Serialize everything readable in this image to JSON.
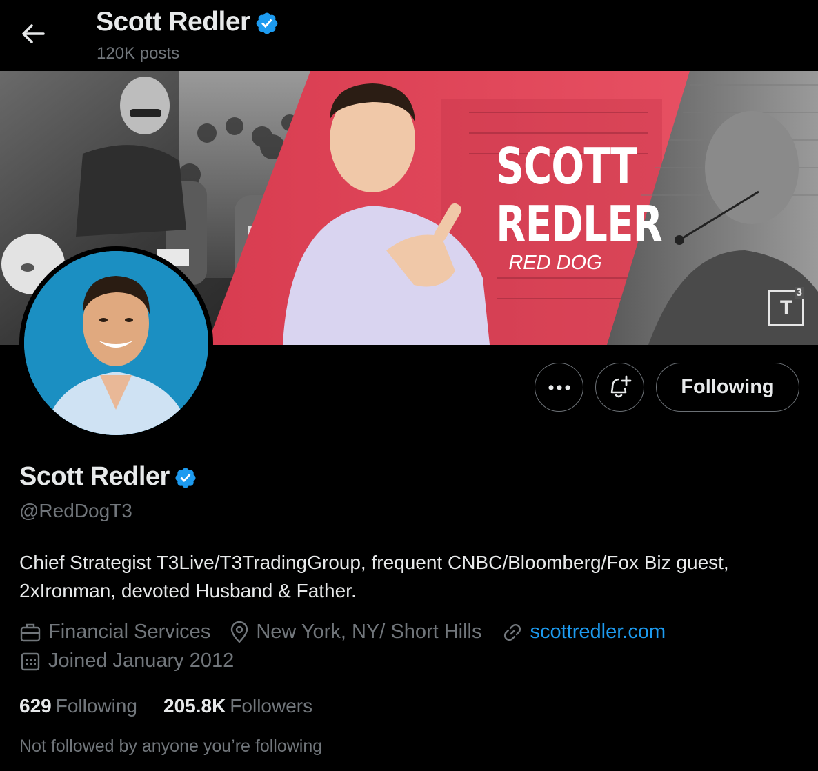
{
  "header": {
    "name": "Scott Redler",
    "posts": "120K posts",
    "back_icon": "arrow-left-icon"
  },
  "banner": {
    "title_line1": "SCOTT",
    "title_line2": "REDLER",
    "subtitle": "RED DOG",
    "logo": "T",
    "logo_sup": "3",
    "accent_color": "#e8465a"
  },
  "actions": {
    "more_icon": "more-horizontal-icon",
    "notify_icon": "bell-plus-icon",
    "follow_label": "Following"
  },
  "profile": {
    "display_name": "Scott Redler",
    "handle": "@RedDogT3",
    "bio": "Chief Strategist T3Live/T3TradingGroup, frequent CNBC/Bloomberg/Fox Biz guest, 2xIronman, devoted Husband & Father.",
    "category": "Financial Services",
    "location": "New York, NY/ Short Hills",
    "website": "scottredler.com",
    "joined": "Joined January 2012"
  },
  "stats": {
    "following_count": "629",
    "following_label": "Following",
    "followers_count": "205.8K",
    "followers_label": "Followers"
  },
  "footer": {
    "not_followed": "Not followed by anyone you’re following"
  },
  "colors": {
    "verified": "#1d9bf0",
    "link": "#1d9bf0",
    "muted": "#71767b",
    "text": "#e7e9ea",
    "avatar_bg": "#1b8fc2"
  }
}
